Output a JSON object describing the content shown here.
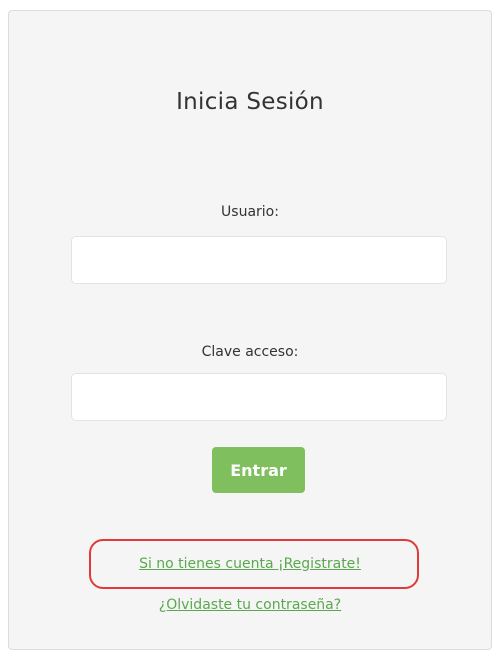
{
  "login": {
    "title": "Inicia Sesión",
    "username_label": "Usuario:",
    "username_value": "",
    "password_label": "Clave acceso:",
    "password_value": "",
    "submit_label": "Entrar",
    "register_link": "Si no tienes cuenta ¡Registrate!",
    "forgot_link": "¿Olvidaste tu contraseña?"
  },
  "colors": {
    "card_background": "#f5f5f5",
    "button_green": "#7fbf5e",
    "link_green": "#5aa84e",
    "highlight_red": "#e03a3a"
  }
}
